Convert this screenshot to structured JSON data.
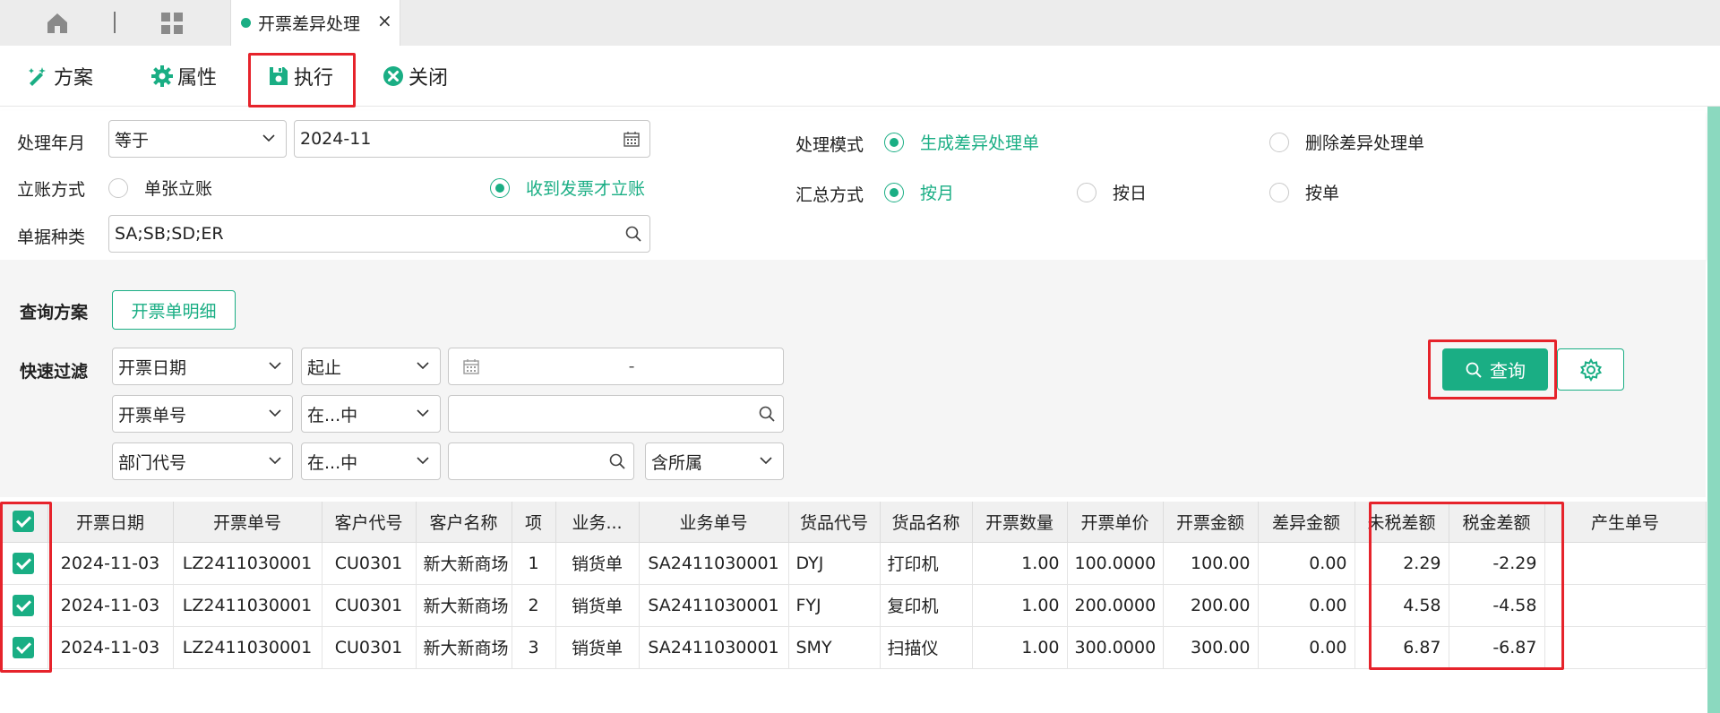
{
  "tabbar": {
    "active_tab": "开票差异处理",
    "close_glyph": "×",
    "home_icon": "home-icon",
    "grid_icon": "grid-icon"
  },
  "toolbar": {
    "scheme_label": "方案",
    "attributes_label": "属性",
    "execute_label": "执行",
    "close_label": "关闭"
  },
  "params": {
    "period_label": "处理年月",
    "period_operator": "等于",
    "period_value": "2024-11",
    "posting_label": "立账方式",
    "posting_options": [
      "单张立账",
      "收到发票才立账"
    ],
    "posting_selected": "收到发票才立账",
    "doctype_label": "单据种类",
    "doctype_value": "SA;SB;SD;ER",
    "mode_label": "处理模式",
    "mode_options": [
      "生成差异处理单",
      "删除差异处理单"
    ],
    "mode_selected": "生成差异处理单",
    "summary_label": "汇总方式",
    "summary_options": [
      "按月",
      "按日",
      "按单"
    ],
    "summary_selected": "按月"
  },
  "query": {
    "plan_label": "查询方案",
    "plan_button": "开票单明细",
    "filter_label": "快速过滤",
    "filters": [
      {
        "field": "开票日期",
        "operator": "起止",
        "value": "-"
      },
      {
        "field": "开票单号",
        "operator": "在...中",
        "value": ""
      },
      {
        "field": "部门代号",
        "operator": "在...中",
        "value": "",
        "extra": "含所属"
      }
    ],
    "query_button": "查询"
  },
  "table": {
    "headers": [
      "开票日期",
      "开票单号",
      "客户代号",
      "客户名称",
      "项",
      "业务...",
      "业务单号",
      "货品代号",
      "货品名称",
      "开票数量",
      "开票单价",
      "开票金额",
      "差异金额",
      "未税差额",
      "税金差额",
      "产生单号"
    ],
    "rows": [
      {
        "checked": true,
        "cells": [
          "2024-11-03",
          "LZ2411030001",
          "CU0301",
          "新大新商场",
          "1",
          "销货单",
          "SA2411030001",
          "DYJ",
          "打印机",
          "1.00",
          "100.0000",
          "100.00",
          "0.00",
          "2.29",
          "-2.29",
          ""
        ]
      },
      {
        "checked": true,
        "cells": [
          "2024-11-03",
          "LZ2411030001",
          "CU0301",
          "新大新商场",
          "2",
          "销货单",
          "SA2411030001",
          "FYJ",
          "复印机",
          "1.00",
          "200.0000",
          "200.00",
          "0.00",
          "4.58",
          "-4.58",
          ""
        ]
      },
      {
        "checked": true,
        "cells": [
          "2024-11-03",
          "LZ2411030001",
          "CU0301",
          "新大新商场",
          "3",
          "销货单",
          "SA2411030001",
          "SMY",
          "扫描仪",
          "1.00",
          "300.0000",
          "300.00",
          "0.00",
          "6.87",
          "-6.87",
          ""
        ]
      }
    ]
  },
  "colors": {
    "accent": "#1aae84",
    "highlight": "#e6232b"
  }
}
